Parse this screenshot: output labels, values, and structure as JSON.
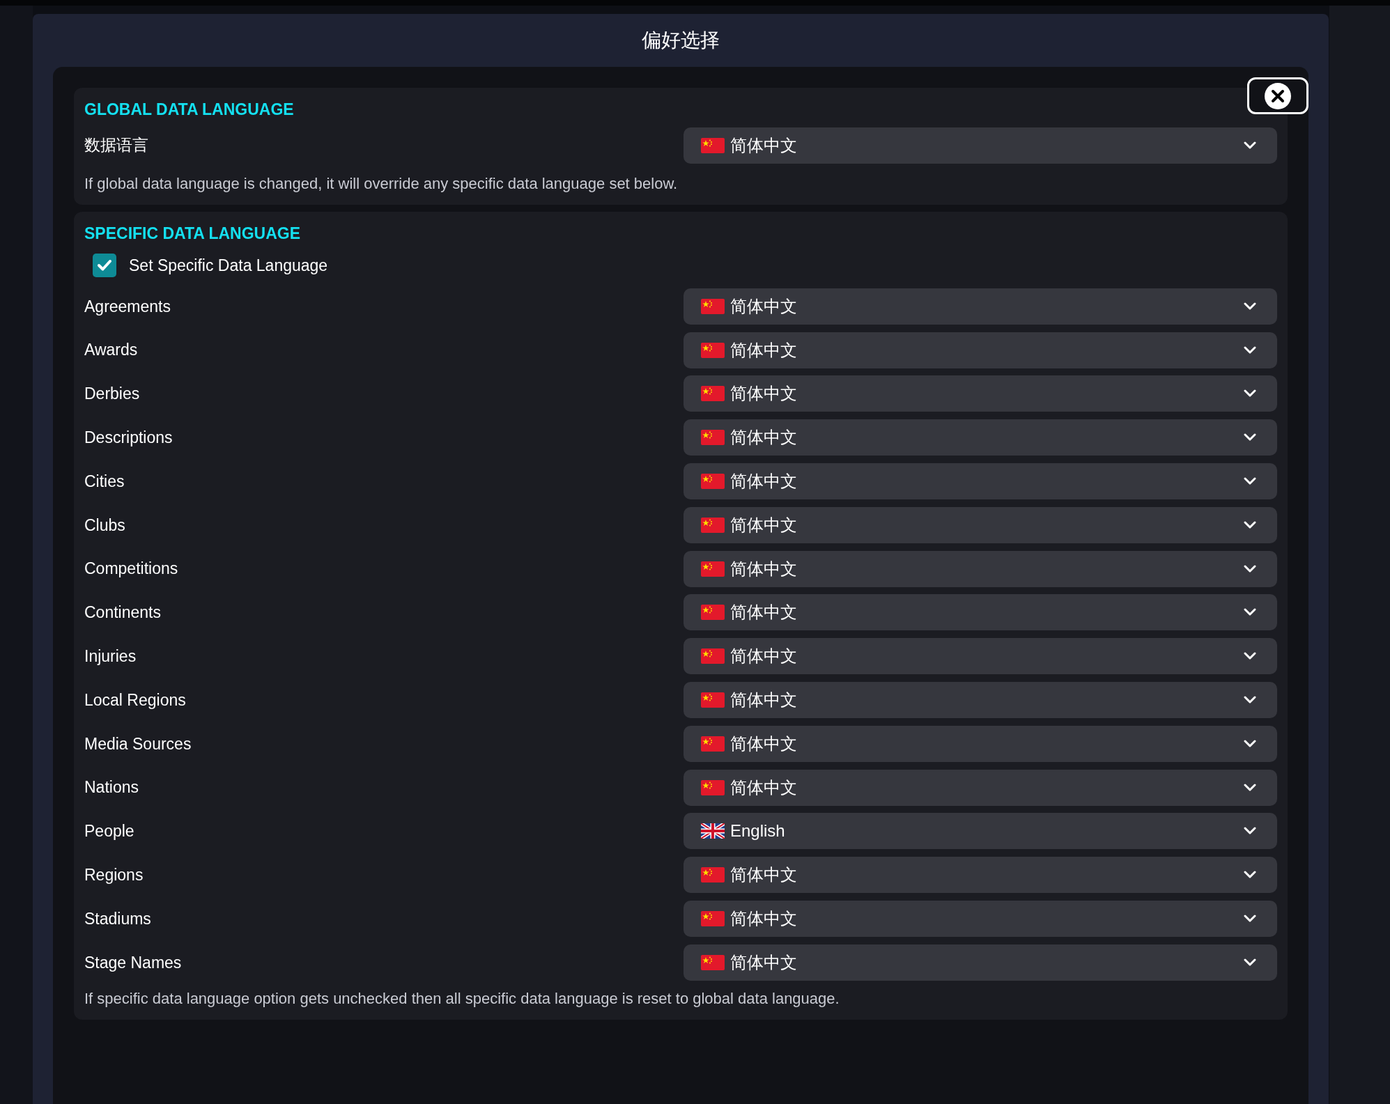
{
  "dialog": {
    "title": "偏好选择"
  },
  "global_section": {
    "heading": "GLOBAL DATA LANGUAGE",
    "label": "数据语言",
    "value": {
      "kind": "cn",
      "text": "简体中文"
    },
    "note": "If global data language is changed, it will override any specific data language set below."
  },
  "specific_section": {
    "heading": "SPECIFIC DATA LANGUAGE",
    "checkbox": {
      "label": "Set Specific Data Language",
      "checked": true
    },
    "rows": [
      {
        "label": "Agreements",
        "kind": "cn",
        "value": "简体中文"
      },
      {
        "label": "Awards",
        "kind": "cn",
        "value": "简体中文"
      },
      {
        "label": "Derbies",
        "kind": "cn",
        "value": "简体中文"
      },
      {
        "label": "Descriptions",
        "kind": "cn",
        "value": "简体中文"
      },
      {
        "label": "Cities",
        "kind": "cn",
        "value": "简体中文"
      },
      {
        "label": "Clubs",
        "kind": "cn",
        "value": "简体中文"
      },
      {
        "label": "Competitions",
        "kind": "cn",
        "value": "简体中文"
      },
      {
        "label": "Continents",
        "kind": "cn",
        "value": "简体中文"
      },
      {
        "label": "Injuries",
        "kind": "cn",
        "value": "简体中文"
      },
      {
        "label": "Local Regions",
        "kind": "cn",
        "value": "简体中文"
      },
      {
        "label": "Media Sources",
        "kind": "cn",
        "value": "简体中文"
      },
      {
        "label": "Nations",
        "kind": "cn",
        "value": "简体中文"
      },
      {
        "label": "People",
        "kind": "gb",
        "value": "English"
      },
      {
        "label": "Regions",
        "kind": "cn",
        "value": "简体中文"
      },
      {
        "label": "Stadiums",
        "kind": "cn",
        "value": "简体中文"
      },
      {
        "label": "Stage Names",
        "kind": "cn",
        "value": "简体中文"
      }
    ],
    "note": "If specific data language option gets unchecked then all specific data language is reset to global data language."
  }
}
